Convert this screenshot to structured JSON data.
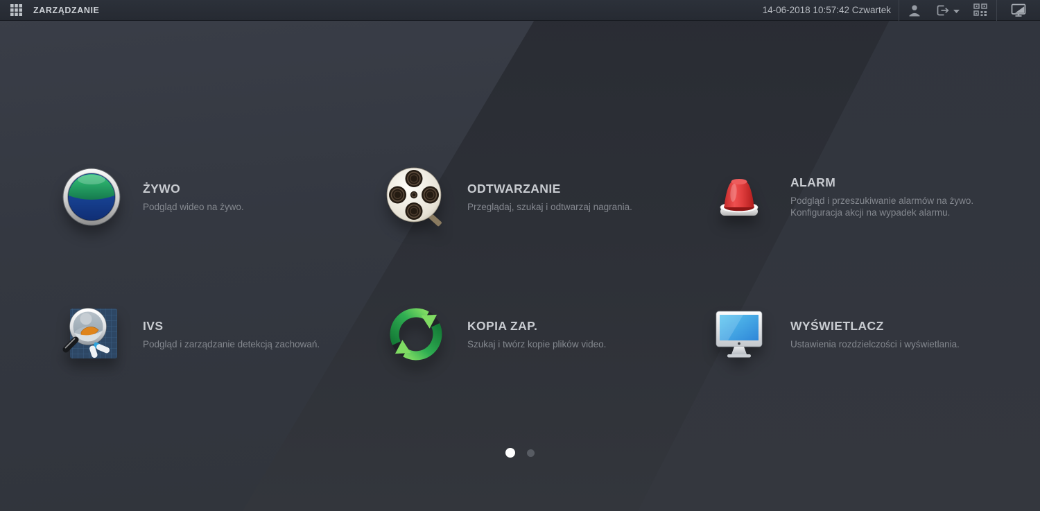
{
  "header": {
    "title": "ZARZĄDZANIE",
    "datetime": "14-06-2018 10:57:42 Czwartek",
    "icons": [
      "apps-grid-icon",
      "user-icon",
      "logout-icon",
      "qr-code-icon",
      "display-switch-icon"
    ]
  },
  "tiles": [
    {
      "id": "live",
      "icon": "live-view-icon",
      "title": "ŻYWO",
      "description_lines": [
        "Podgląd wideo na żywo."
      ]
    },
    {
      "id": "playback",
      "icon": "playback-icon",
      "title": "ODTWARZANIE",
      "description_lines": [
        "Przeglądaj, szukaj i odtwarzaj nagrania."
      ]
    },
    {
      "id": "alarm",
      "icon": "alarm-icon",
      "title": "ALARM",
      "description_lines": [
        "Podgląd i przeszukiwanie alarmów na żywo.",
        "Konfiguracja akcji na wypadek alarmu."
      ]
    },
    {
      "id": "ivs",
      "icon": "ivs-icon",
      "title": "IVS",
      "description_lines": [
        "Podgląd i zarządzanie detekcją zachowań."
      ]
    },
    {
      "id": "backup",
      "icon": "backup-icon",
      "title": "KOPIA ZAP.",
      "description_lines": [
        "Szukaj i twórz kopie plików video."
      ]
    },
    {
      "id": "display",
      "icon": "display-icon",
      "title": "WYŚWIETLACZ",
      "description_lines": [
        "Ustawienia rozdzielczości i wyświetlania."
      ]
    }
  ],
  "pagination": {
    "total_pages": 2,
    "active_page": 1
  },
  "colors": {
    "header_bg": "#262a32",
    "background": "#2d3037",
    "alarm_red": "#d93a3a",
    "backup_green": "#2eaf4e",
    "live_green": "#2bb169",
    "live_blue": "#16439c",
    "display_screen_blue": "#3fa9e0",
    "active_dot": "#ffffff",
    "inactive_dot": "#585c63"
  }
}
